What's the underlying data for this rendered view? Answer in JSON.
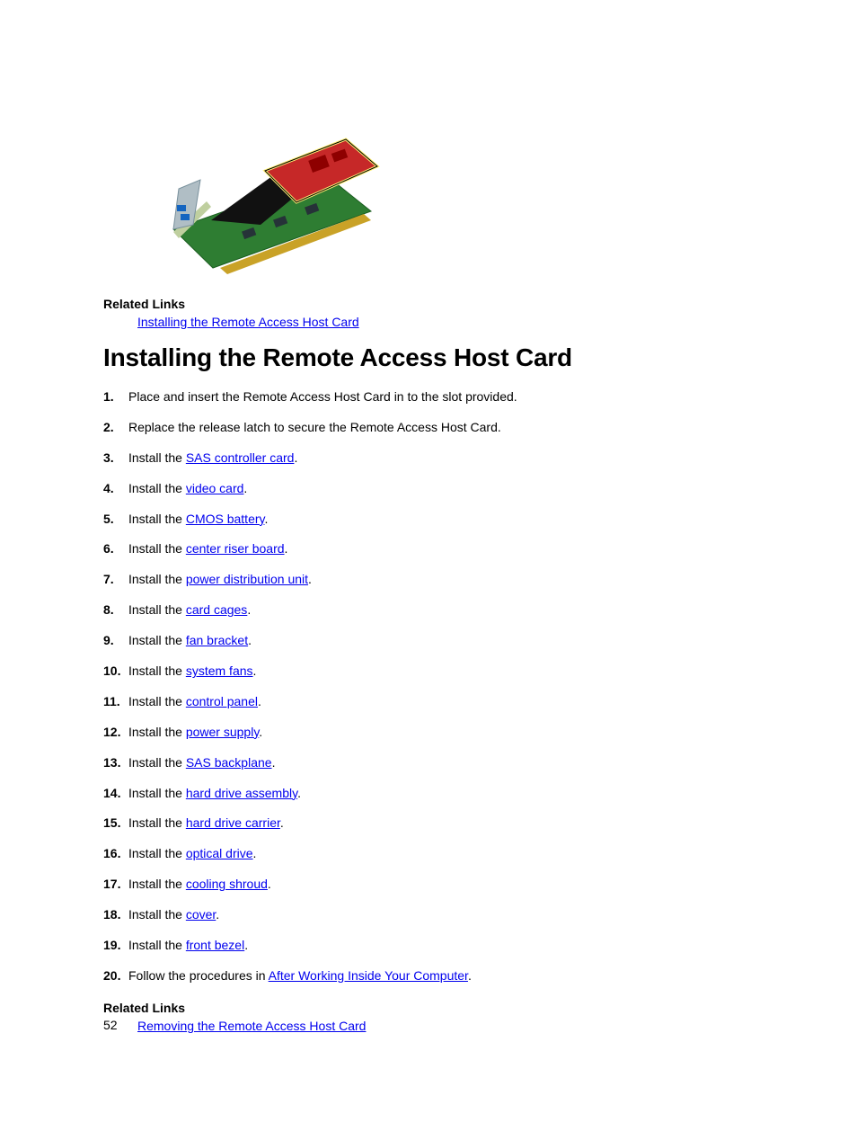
{
  "relatedLinks1": {
    "label": "Related Links",
    "link": "Installing the Remote Access Host Card"
  },
  "heading": "Installing the Remote Access Host Card",
  "steps": [
    {
      "num": "1.",
      "pre": "Place and insert the Remote Access Host Card in to the slot provided.",
      "link": "",
      "post": ""
    },
    {
      "num": "2.",
      "pre": "Replace the release latch to secure the Remote Access Host Card.",
      "link": "",
      "post": ""
    },
    {
      "num": "3.",
      "pre": "Install the ",
      "link": "SAS controller card",
      "post": "."
    },
    {
      "num": "4.",
      "pre": "Install the ",
      "link": "video card",
      "post": "."
    },
    {
      "num": "5.",
      "pre": "Install the ",
      "link": "CMOS battery",
      "post": "."
    },
    {
      "num": "6.",
      "pre": "Install the ",
      "link": "center riser board",
      "post": "."
    },
    {
      "num": "7.",
      "pre": "Install the ",
      "link": "power distribution unit",
      "post": "."
    },
    {
      "num": "8.",
      "pre": "Install the ",
      "link": "card cages",
      "post": "."
    },
    {
      "num": "9.",
      "pre": "Install the ",
      "link": "fan bracket",
      "post": "."
    },
    {
      "num": "10.",
      "pre": "Install the ",
      "link": "system fans",
      "post": "."
    },
    {
      "num": "11.",
      "pre": "Install the ",
      "link": "control panel",
      "post": "."
    },
    {
      "num": "12.",
      "pre": "Install the ",
      "link": "power supply",
      "post": "."
    },
    {
      "num": "13.",
      "pre": "Install the ",
      "link": "SAS backplane",
      "post": "."
    },
    {
      "num": "14.",
      "pre": "Install the ",
      "link": "hard drive assembly",
      "post": "."
    },
    {
      "num": "15.",
      "pre": "Install the ",
      "link": "hard drive carrier",
      "post": "."
    },
    {
      "num": "16.",
      "pre": "Install the ",
      "link": "optical drive",
      "post": "."
    },
    {
      "num": "17.",
      "pre": "Install the ",
      "link": "cooling shroud",
      "post": "."
    },
    {
      "num": "18.",
      "pre": "Install the ",
      "link": "cover",
      "post": "."
    },
    {
      "num": "19.",
      "pre": "Install the ",
      "link": "front bezel",
      "post": "."
    },
    {
      "num": "20.",
      "pre": "Follow the procedures in ",
      "link": "After Working Inside Your Computer",
      "post": "."
    }
  ],
  "relatedLinks2": {
    "label": "Related Links",
    "link": "Removing the Remote Access Host Card"
  },
  "pageNumber": "52"
}
